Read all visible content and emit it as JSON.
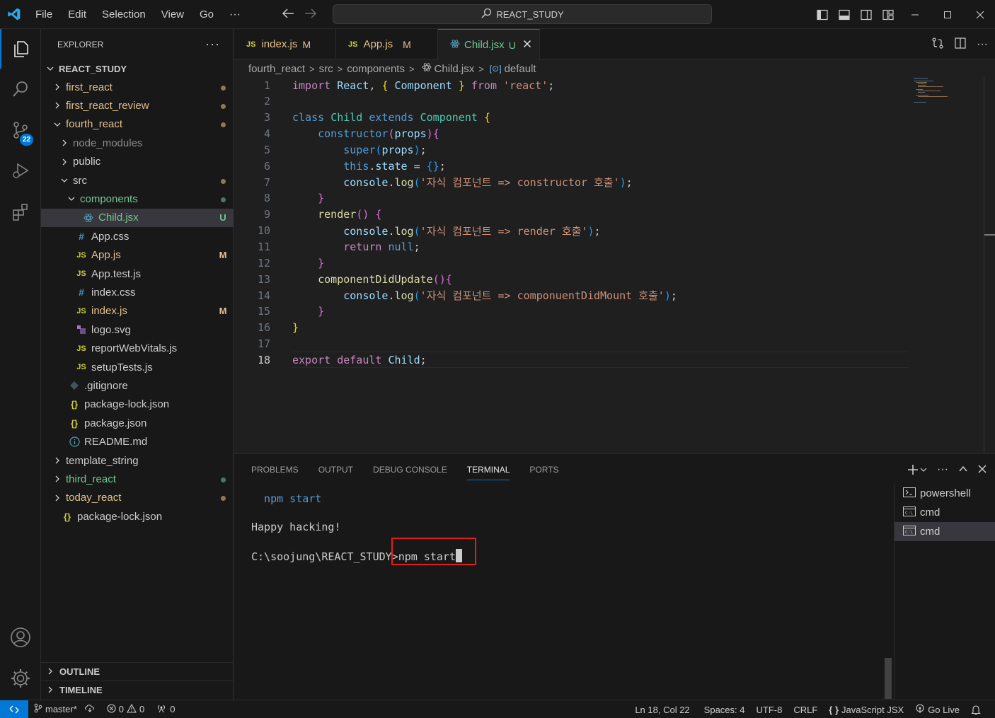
{
  "titlebar": {
    "menu": [
      "File",
      "Edit",
      "Selection",
      "View",
      "Go"
    ],
    "more": "···",
    "search_text": "REACT_STUDY"
  },
  "activitybar": {
    "scm_badge": "22"
  },
  "explorer": {
    "header": "EXPLORER",
    "more": "···",
    "root": "REACT_STUDY",
    "items": [
      {
        "label": "first_react",
        "deco": "dot"
      },
      {
        "label": "first_react_review",
        "deco": "dot"
      },
      {
        "label": "fourth_react",
        "deco": "dot"
      },
      {
        "label": "node_modules",
        "deco": ""
      },
      {
        "label": "public",
        "deco": ""
      },
      {
        "label": "src",
        "deco": "dot"
      },
      {
        "label": "components",
        "deco": "dot-green"
      },
      {
        "label": "Child.jsx",
        "deco": "U"
      },
      {
        "label": "App.css",
        "deco": ""
      },
      {
        "label": "App.js",
        "deco": "M"
      },
      {
        "label": "App.test.js",
        "deco": ""
      },
      {
        "label": "index.css",
        "deco": ""
      },
      {
        "label": "index.js",
        "deco": "M"
      },
      {
        "label": "logo.svg",
        "deco": ""
      },
      {
        "label": "reportWebVitals.js",
        "deco": ""
      },
      {
        "label": "setupTests.js",
        "deco": ""
      },
      {
        "label": ".gitignore",
        "deco": ""
      },
      {
        "label": "package-lock.json",
        "deco": ""
      },
      {
        "label": "package.json",
        "deco": ""
      },
      {
        "label": "README.md",
        "deco": ""
      },
      {
        "label": "template_string",
        "deco": ""
      },
      {
        "label": "third_react",
        "deco": "dot-green"
      },
      {
        "label": "today_react",
        "deco": "dot"
      },
      {
        "label": "package-lock.json",
        "deco": ""
      }
    ],
    "outline": "OUTLINE",
    "timeline": "TIMELINE"
  },
  "tabs": [
    {
      "icon": "JS",
      "label": "index.js",
      "deco": "M"
    },
    {
      "icon": "JS",
      "label": "App.js",
      "deco": "M"
    },
    {
      "icon": "react-icon",
      "label": "Child.jsx",
      "deco": "U"
    }
  ],
  "breadcrumb": [
    "fourth_react",
    "src",
    "components",
    "Child.jsx",
    "default"
  ],
  "editor": {
    "line_numbers": [
      "1",
      "2",
      "3",
      "4",
      "5",
      "6",
      "7",
      "8",
      "9",
      "10",
      "11",
      "12",
      "13",
      "14",
      "15",
      "16",
      "17",
      "18"
    ],
    "current_line": "18",
    "lines": [
      "import React, { Component } from 'react';",
      "",
      "class Child extends Component {",
      "    constructor(props){",
      "        super(props);",
      "        this.state = {};",
      "        console.log('자식 컴포넌트 => constructor 호출');",
      "    }",
      "    render() {",
      "        console.log('자식 컴포넌트 => render 호출');",
      "        return null;",
      "    }",
      "    componentDidUpdate(){",
      "        console.log('자식 컴포넌트 => componuentDidMount 호출');",
      "    }",
      "}",
      "",
      "export default Child;"
    ],
    "tokens": {
      "import": "import",
      "React": "React",
      "Component": "Component",
      "from": "from",
      "react_str": "'react'",
      "class": "class",
      "Child": "Child",
      "extends": "extends",
      "constructor": "constructor",
      "props": "props",
      "super": "super",
      "this": "this",
      "state": "state",
      "console": "console",
      "log": "log",
      "str1": "'자식 컴포넌트 => constructor 호출'",
      "render": "render",
      "str2": "'자식 컴포넌트 => render 호출'",
      "return": "return",
      "null": "null",
      "componentDidUpdate": "componentDidUpdate",
      "str3": "'자식 컴포넌트 => componuentDidMount 호출'",
      "export": "export",
      "default": "default"
    }
  },
  "panel": {
    "tabs": [
      "PROBLEMS",
      "OUTPUT",
      "DEBUG CONSOLE",
      "TERMINAL",
      "PORTS"
    ],
    "active_tab": "TERMINAL",
    "terminal_lines": {
      "l1": "  npm start",
      "l2": "Happy hacking!",
      "prompt": "C:\\soojung\\REACT_STUDY>",
      "command": "npm start"
    },
    "terminals": [
      "powershell",
      "cmd",
      "cmd"
    ]
  },
  "statusbar": {
    "branch": "master*",
    "errors": "0",
    "warnings": "0",
    "ports": "0",
    "position": "Ln 18, Col 22",
    "spaces": "Spaces: 4",
    "encoding": "UTF-8",
    "eol": "CRLF",
    "language": "JavaScript JSX",
    "golive": "Go Live"
  },
  "colors": {
    "accent": "#0078d4",
    "modified": "#e2c08d",
    "untracked": "#73c991"
  }
}
